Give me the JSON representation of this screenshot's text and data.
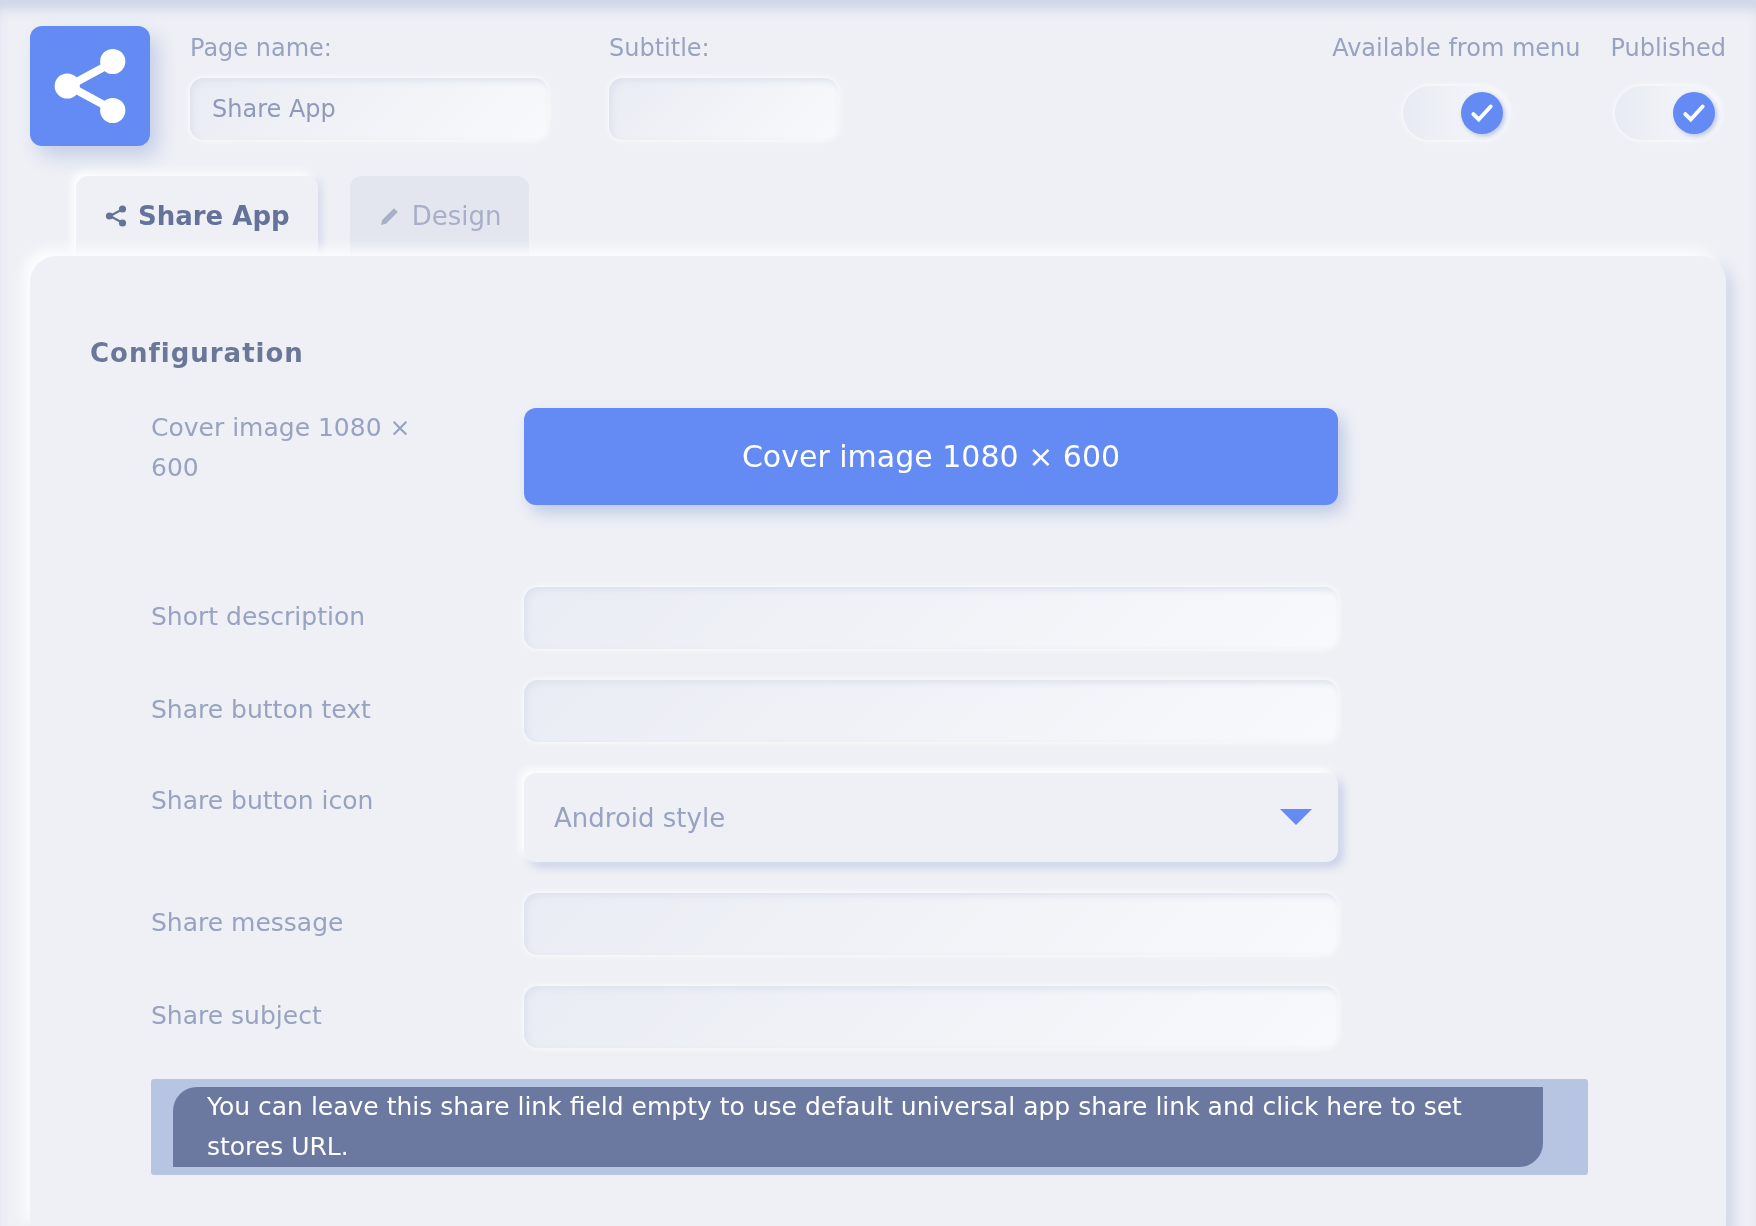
{
  "header": {
    "page_name": {
      "label": "Page name:",
      "value": "Share App"
    },
    "subtitle": {
      "label": "Subtitle:"
    },
    "toggles": [
      {
        "label": "Available from menu",
        "on": true
      },
      {
        "label": "Published",
        "on": true
      }
    ]
  },
  "tabs": [
    {
      "label": "Share App",
      "kind": "share",
      "selected": true
    },
    {
      "label": "Design",
      "kind": "edit",
      "selected": false
    }
  ],
  "section_title": "Configuration",
  "rows": [
    {
      "kind": "button",
      "label": "Cover image 1080 × 600",
      "button": "Cover image 1080 × 600"
    },
    {
      "kind": "field",
      "label": "Short description"
    },
    {
      "kind": "field",
      "label": "Share button text"
    },
    {
      "kind": "select",
      "label": "Share button icon",
      "value": "Android style"
    },
    {
      "kind": "field",
      "label": "Share message"
    },
    {
      "kind": "field",
      "label": "Share subject"
    }
  ],
  "notice": "You can leave this share link field empty to use default universal app share link and click here to set stores URL."
}
